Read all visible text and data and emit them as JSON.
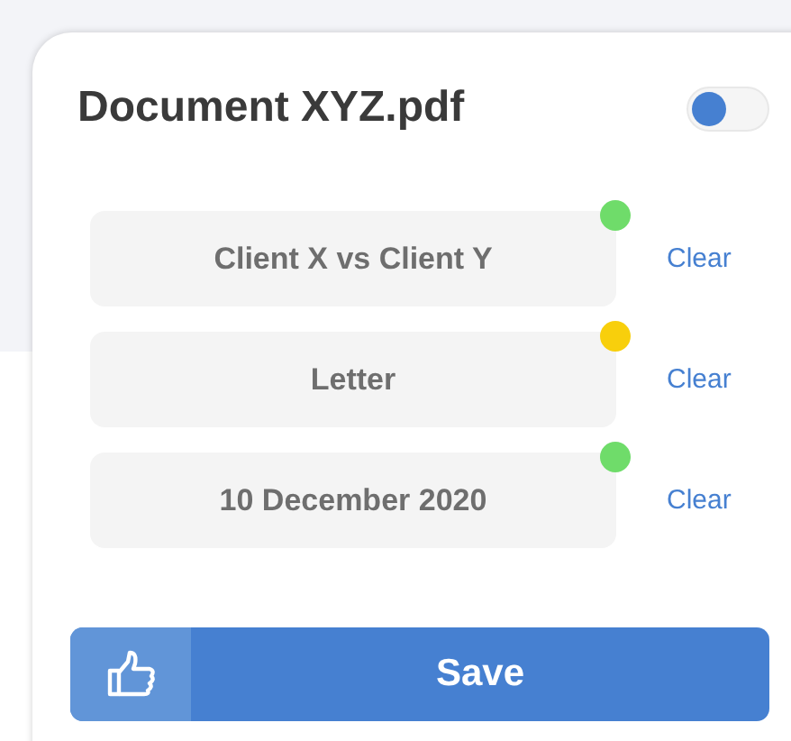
{
  "title": "Document XYZ.pdf",
  "toggle": {
    "on": false
  },
  "fields": [
    {
      "value": "Client X vs Client Y",
      "color": "#6fdc6a",
      "action": "Clear"
    },
    {
      "value": "Letter",
      "color": "#f8cf0c",
      "action": "Clear"
    },
    {
      "value": "10 December 2020",
      "color": "#6fdc6a",
      "action": "Clear"
    }
  ],
  "save_button": {
    "label": "Save"
  }
}
